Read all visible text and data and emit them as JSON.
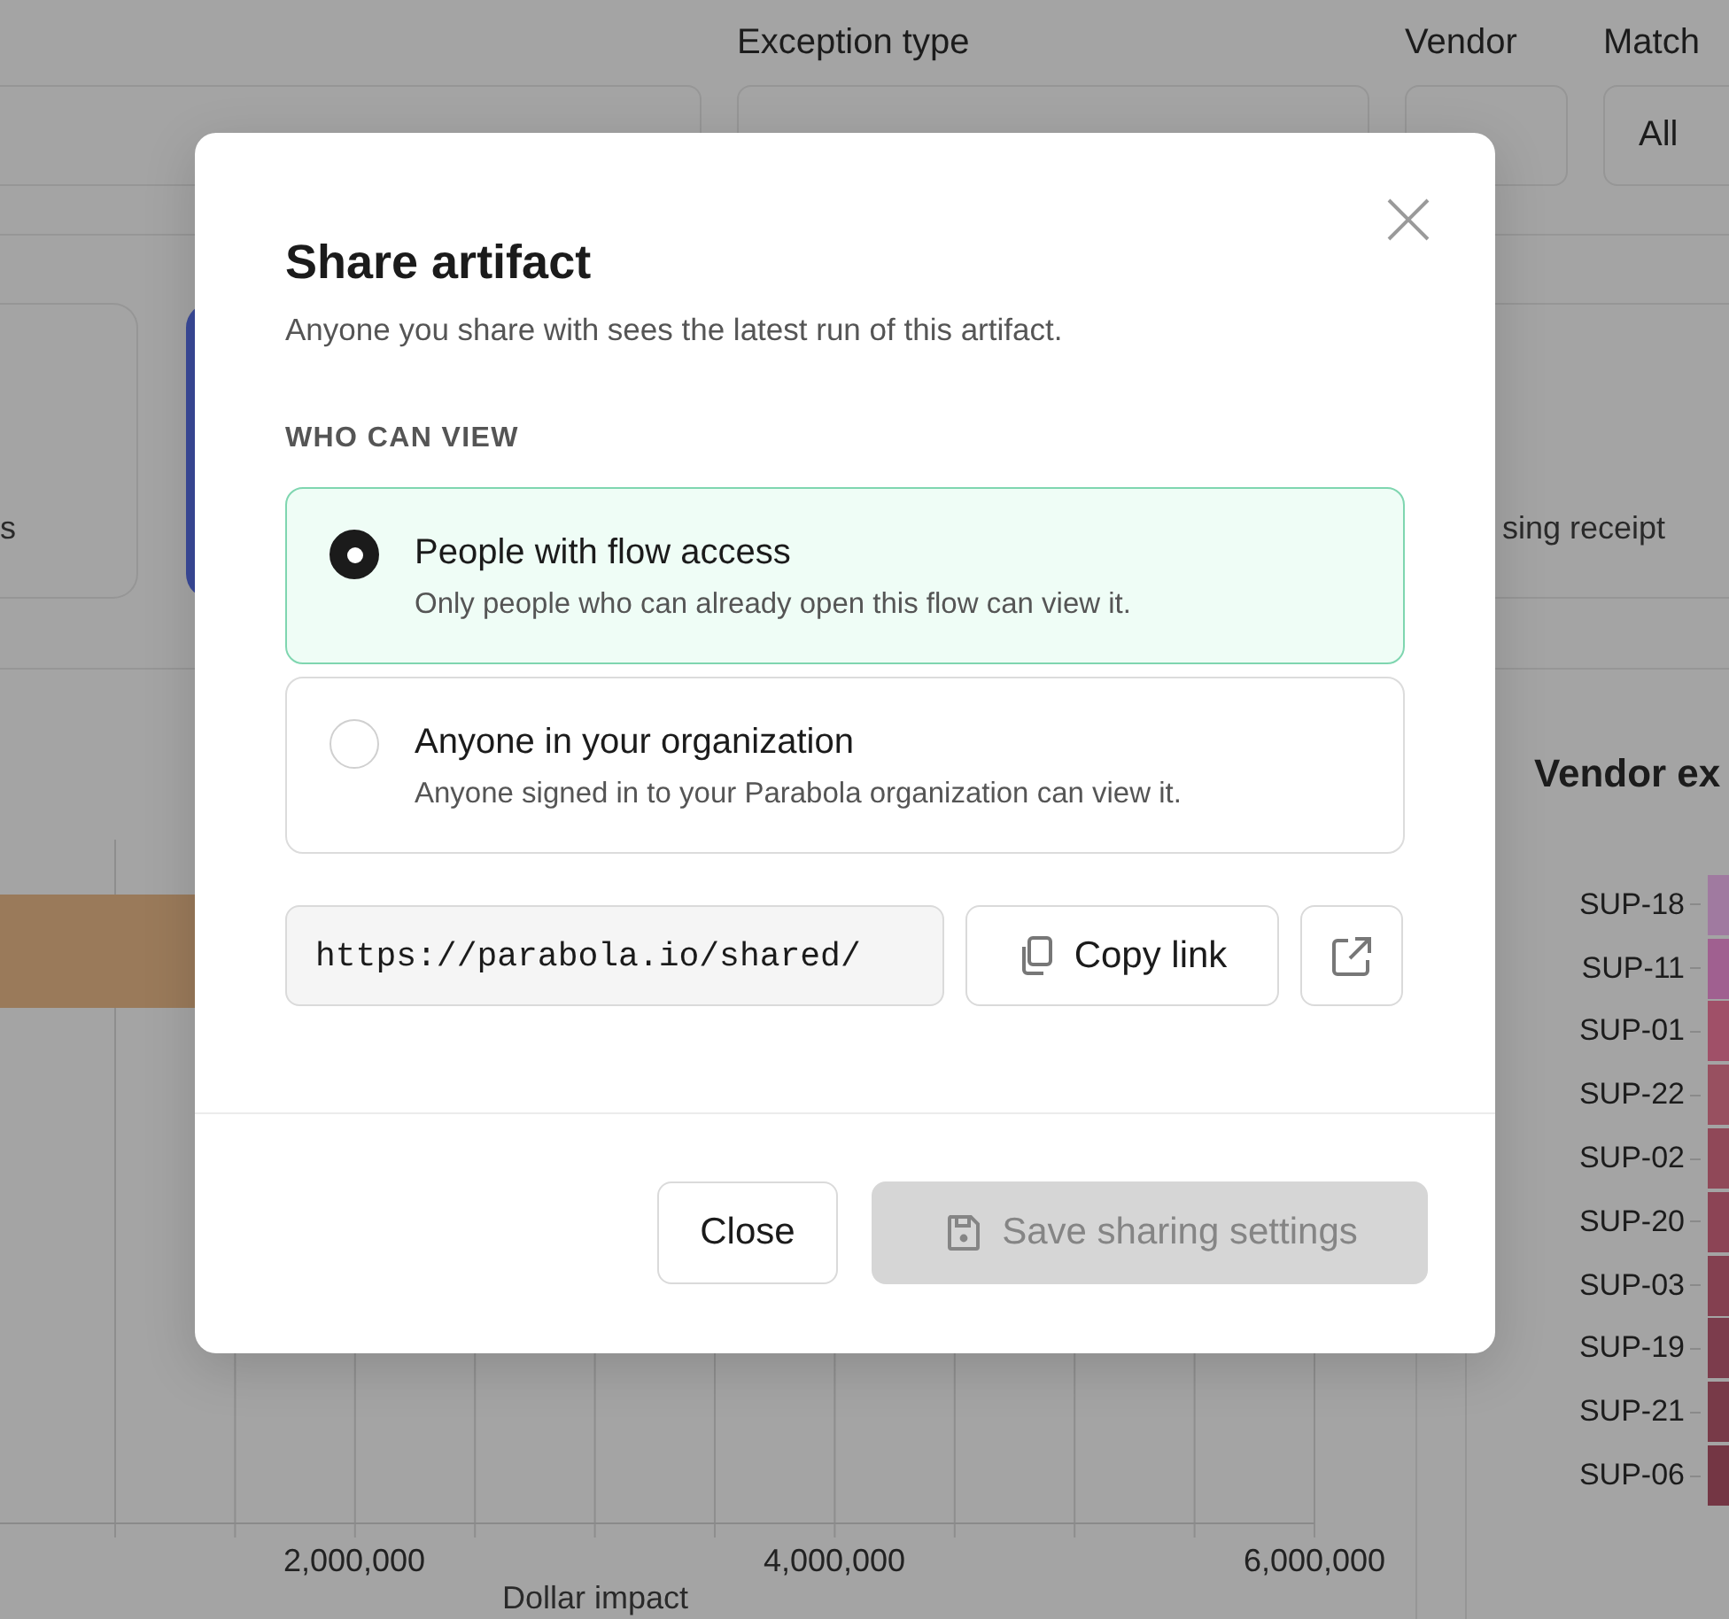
{
  "filters": [
    {
      "label": "Exception type"
    },
    {
      "label": "Vendor"
    },
    {
      "label": "Match",
      "value": "All"
    }
  ],
  "cards": [
    {
      "text": "s",
      "selected": false
    },
    {
      "selected": true
    },
    {
      "text": "sing receipt",
      "selected": false
    }
  ],
  "impact_chart": {
    "ticks": [
      "2,000,000",
      "4,000,000",
      "6,000,000"
    ],
    "axis_title": "Dollar impact"
  },
  "vendor_chart": {
    "title": "Vendor ex",
    "vendors": [
      {
        "name": "SUP-18",
        "color": "#a07aa0"
      },
      {
        "name": "SUP-11",
        "color": "#a06090"
      },
      {
        "name": "SUP-01",
        "color": "#a05068"
      },
      {
        "name": "SUP-22",
        "color": "#985060"
      },
      {
        "name": "SUP-02",
        "color": "#904858"
      },
      {
        "name": "SUP-20",
        "color": "#8c4455"
      },
      {
        "name": "SUP-03",
        "color": "#844050"
      },
      {
        "name": "SUP-19",
        "color": "#7c3c4c"
      },
      {
        "name": "SUP-21",
        "color": "#783a48"
      },
      {
        "name": "SUP-06",
        "color": "#743644"
      }
    ]
  },
  "dialog": {
    "title": "Share artifact",
    "subtitle": "Anyone you share with sees the latest run of this artifact.",
    "section_label": "WHO CAN VIEW",
    "options": [
      {
        "title": "People with flow access",
        "description": "Only people who can already open this flow can view it.",
        "selected": true
      },
      {
        "title": "Anyone in your organization",
        "description": "Anyone signed in to your Parabola organization can view it.",
        "selected": false
      }
    ],
    "link": {
      "value": "https://parabola.io/shared/"
    },
    "copy_button": {
      "label": "Copy link"
    },
    "close_button": {
      "label": "Close"
    },
    "save_button": {
      "label": "Save sharing settings",
      "disabled": true
    }
  }
}
